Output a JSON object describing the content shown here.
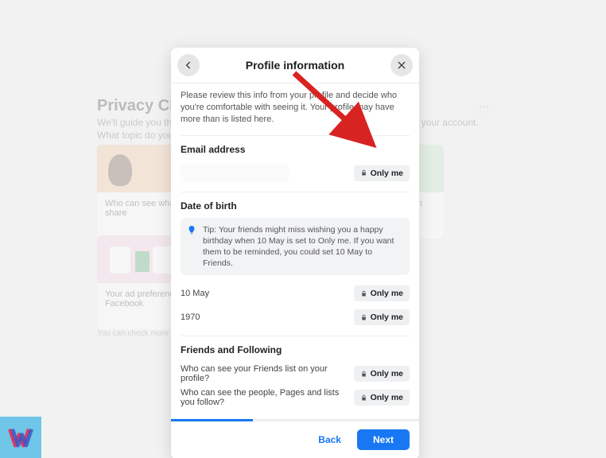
{
  "background": {
    "title": "Privacy Checkup",
    "subtitle1": "We'll guide you through some settings so you can make the right choices for your account.",
    "subtitle2": "What topic do you want to start with?",
    "cards": [
      {
        "label": "Who can see what you share"
      },
      {
        "label": ""
      },
      {
        "label": "Your data settings on Facebook"
      }
    ],
    "cards2": [
      {
        "label": "Your ad preferences on Facebook"
      }
    ],
    "footnote": "You can check more privacy settings on Facebook in Settings."
  },
  "modal": {
    "title": "Profile information",
    "description": "Please review this info from your profile and decide who you're comfortable with seeing it. Your profile may have more than is listed here.",
    "sections": {
      "email": {
        "heading": "Email address",
        "value": "",
        "audience": "Only me"
      },
      "dob": {
        "heading": "Date of birth",
        "tip": "Tip: Your friends might miss wishing you a happy birthday when 10 May is set to Only me. If you want them to be reminded, you could set 10 May to Friends.",
        "rows": [
          {
            "label": "10 May",
            "audience": "Only me"
          },
          {
            "label": "1970",
            "audience": "Only me"
          }
        ]
      },
      "friends": {
        "heading": "Friends and Following",
        "rows": [
          {
            "label": "Who can see your Friends list on your profile?",
            "audience": "Only me"
          },
          {
            "label": "Who can see the people, Pages and lists you follow?",
            "audience": "Only me"
          }
        ]
      }
    },
    "footer": {
      "back": "Back",
      "next": "Next"
    }
  },
  "logo": "W"
}
